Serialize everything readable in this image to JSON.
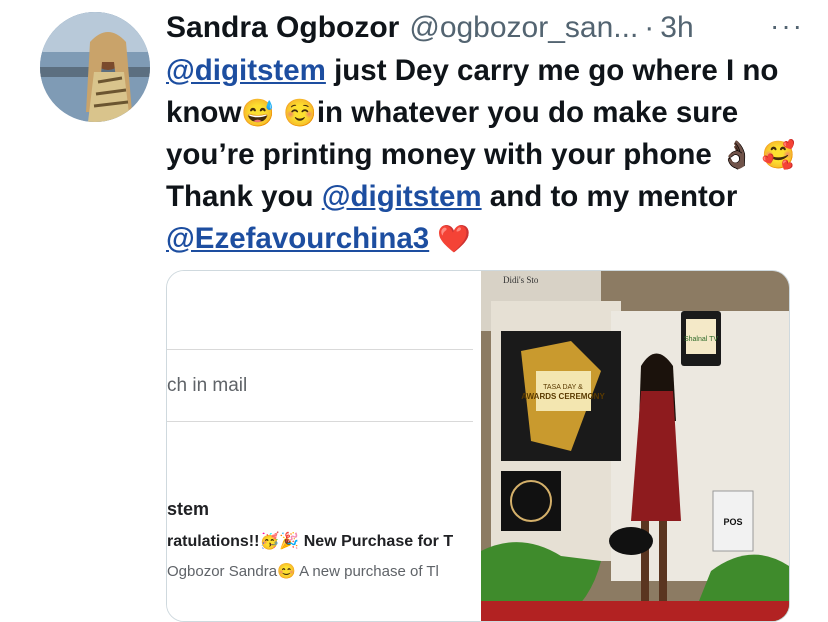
{
  "tweet": {
    "author_name": "Sandra Ogbozor",
    "author_handle": "@ogbozor_san...",
    "dot": "·",
    "time": "3h",
    "more": "···",
    "text": {
      "mention1": "@digitstem",
      "part1": " just Dey carry me go where I no know",
      "emoji1": "😅",
      "emoji2": "☺️",
      "part2": "in whatever you do make sure you’re printing money with your phone ",
      "emoji3": "👌🏿",
      "emoji4": "🥰",
      "part3": " Thank you ",
      "mention2": "@digitstem",
      "part4": " and to my mentor ",
      "mention3": "@Ezefavourchina3",
      "emoji5": "❤️"
    }
  },
  "media": {
    "email_screenshot": {
      "search_text": "ch in mail",
      "sender": "stem",
      "subject": "ratulations!!🥳🎉 New Purchase for T",
      "preview": "Ogbozor Sandra😊 A new purchase of Tl"
    },
    "photo": {
      "banner_title": "AWARDS CEREMONY",
      "banner_sub": "TASA DAY &",
      "tv_text": "Shalnal TV",
      "pos_text": "POS",
      "top_sign": "Didi's Sto"
    }
  },
  "colors": {
    "mention": "#1d4ea0",
    "secondary_text": "#536471",
    "dress": "#8e1b1e",
    "backdrop": "#e7e3da"
  }
}
